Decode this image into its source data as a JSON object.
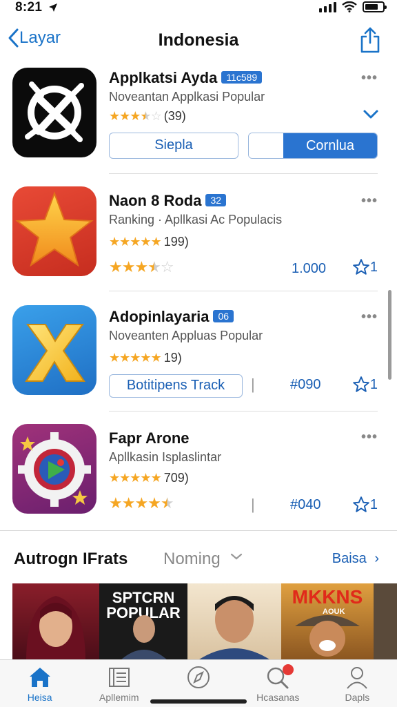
{
  "status_bar": {
    "time": "8:21"
  },
  "nav": {
    "back_label": "Layar",
    "title": "Indonesia"
  },
  "apps": [
    {
      "name": "Applkatsi Ayda",
      "badge": "11c589",
      "subtitle": "Noveantan Applkasi Popular",
      "rating_stars": 3.5,
      "rating_text": "(39)",
      "button_primary": "Siepla",
      "button_secondary": "Cornlua"
    },
    {
      "name": "Naon 8 Roda",
      "badge": "32",
      "subtitle": "Ranking · Apllkasi Ac Populacis",
      "rating_stars": 5,
      "rating_text": "199)",
      "secondary_stars": 3.5,
      "metric": "1.000",
      "star_count": "1"
    },
    {
      "name": "Adopinlayaria",
      "badge": "06",
      "subtitle": "Noveanten Appluas Popular",
      "rating_stars": 5,
      "rating_text": "19)",
      "button_label": "Botitipens Track",
      "metric": "#090",
      "star_count": "1"
    },
    {
      "name": "Fapr Arone",
      "badge": "",
      "subtitle": "Apllkasin Isplaslintar",
      "rating_stars": 5,
      "rating_text": "709)",
      "secondary_stars": 4.5,
      "metric": "#040",
      "star_count": "1"
    }
  ],
  "section": {
    "title": "Autrogn IFrats",
    "filter": "Noming",
    "link": "Baisa"
  },
  "posters": [
    {
      "text": "",
      "sub": ""
    },
    {
      "text": "SPTCRN POPULAR",
      "sub": ""
    },
    {
      "text": "",
      "sub": ""
    },
    {
      "text": "MKKNS",
      "sub": "AOUK"
    },
    {
      "text": "",
      "sub": ""
    }
  ],
  "tabs": [
    {
      "label": "Heisa",
      "icon": "home-icon",
      "active": true
    },
    {
      "label": "Apllemim",
      "icon": "list-icon",
      "active": false
    },
    {
      "label": "",
      "icon": "compass-icon",
      "active": false
    },
    {
      "label": "Hcasanas",
      "icon": "search-icon",
      "active": false
    },
    {
      "label": "Dapls",
      "icon": "person-icon",
      "active": false
    }
  ],
  "colors": {
    "accent": "#1a73c8",
    "button_fill": "#2a74d0",
    "star": "#f5a623"
  }
}
